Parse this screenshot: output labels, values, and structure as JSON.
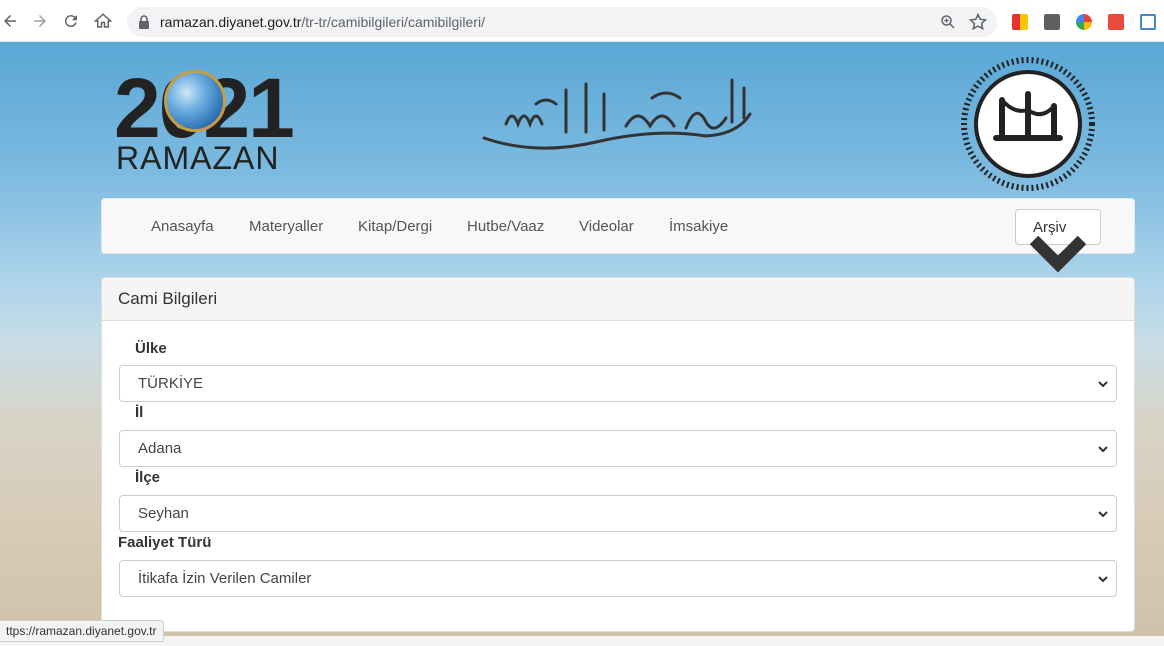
{
  "browser": {
    "url_host": "ramazan.diyanet.gov.tr",
    "url_path": "/tr-tr/camibilgileri/camibilgileri/",
    "status_url": "ttps://ramazan.diyanet.gov.tr"
  },
  "header": {
    "logo_year": "2021",
    "logo_word": "RAMAZAN",
    "diyanet_ring_text": "DİYANET İŞLERİ BAŞKANLIĞI"
  },
  "nav": {
    "links": [
      "Anasayfa",
      "Materyaller",
      "Kitap/Dergi",
      "Hutbe/Vaaz",
      "Videolar",
      "İmsakiye"
    ],
    "archive": "Arşiv"
  },
  "panel": {
    "title": "Cami Bilgileri",
    "fields": [
      {
        "label": "Ülke",
        "value": "TÜRKİYE"
      },
      {
        "label": "İl",
        "value": "Adana"
      },
      {
        "label": "İlçe",
        "value": "Seyhan"
      },
      {
        "label": "Faaliyet Türü",
        "value": "İtikafa İzin Verilen Camiler"
      }
    ]
  },
  "colors": {
    "nav_bg": "#f8f8f8",
    "panel_heading_bg": "#f5f5f5",
    "sky_top": "#5aa7d5"
  },
  "icons": {
    "back": "back-arrow-icon",
    "forward": "forward-arrow-icon",
    "reload": "reload-icon",
    "home": "home-icon",
    "lock": "lock-icon",
    "zoom": "zoom-icon",
    "bookmark": "star-icon"
  }
}
